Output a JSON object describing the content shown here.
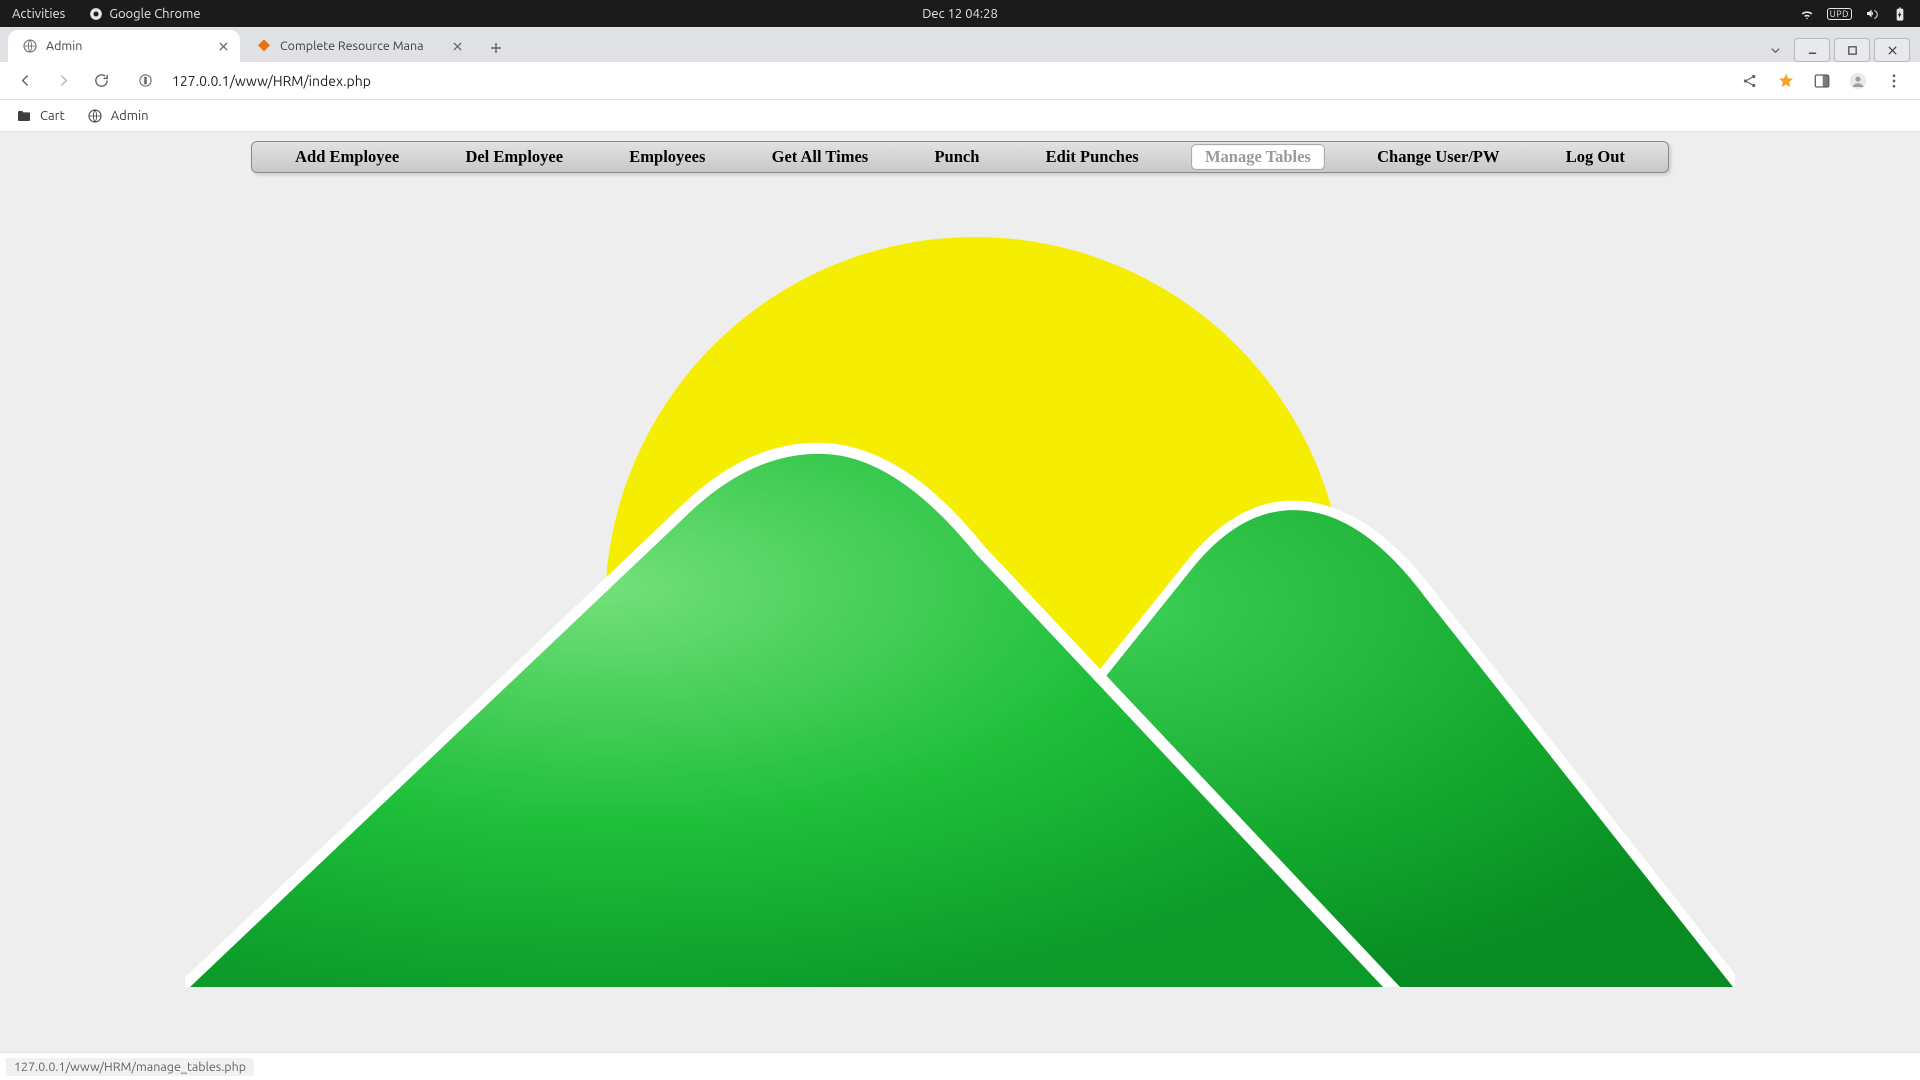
{
  "gnome": {
    "activities": "Activities",
    "app": "Google Chrome",
    "clock": "Dec 12  04:28",
    "upd_badge": "UPD"
  },
  "tabs": [
    {
      "title": "Admin",
      "active": true
    },
    {
      "title": "Complete Resource Mana",
      "active": false
    }
  ],
  "address": {
    "url": "127.0.0.1/www/HRM/index.php"
  },
  "bookmarks": [
    {
      "label": "Cart",
      "icon": "folder"
    },
    {
      "label": "Admin",
      "icon": "globe"
    }
  ],
  "menu": {
    "items": [
      "Add Employee",
      "Del Employee",
      "Employees",
      "Get All Times",
      "Punch",
      "Edit Punches",
      "Manage Tables",
      "Change User/PW",
      "Log Out"
    ],
    "hovered": "Manage Tables"
  },
  "status": {
    "hover_url": "127.0.0.1/www/HRM/manage_tables.php"
  },
  "colors": {
    "sun": "#f6ee00",
    "hill_light": "#5fd75f",
    "hill_mid": "#18b531",
    "hill_dark": "#0a8f25",
    "star": "#f6a428"
  }
}
